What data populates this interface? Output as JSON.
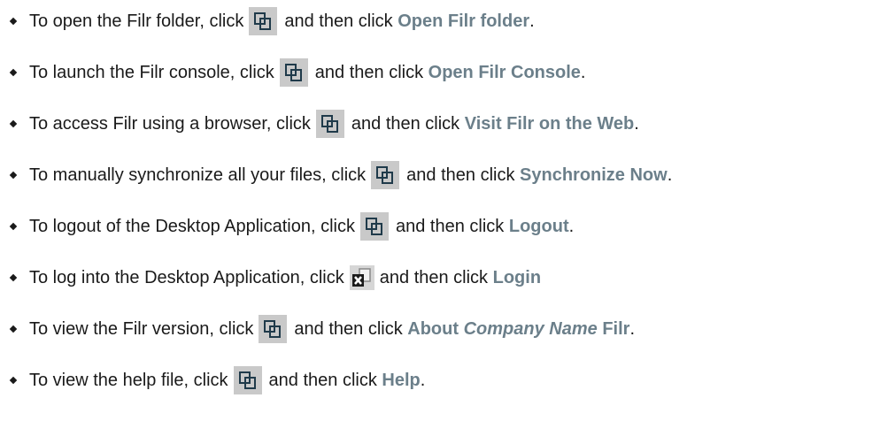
{
  "items": [
    {
      "prefix": "To open the Filr folder, click",
      "middle": "and then click",
      "command": "Open Filr folder",
      "end": ".",
      "icon": "filr-icon"
    },
    {
      "prefix": "To launch the Filr console, click",
      "middle": "and then click",
      "command": "Open Filr Console",
      "end": ".",
      "icon": "filr-icon"
    },
    {
      "prefix": "To access Filr using a browser, click",
      "middle": "and then click",
      "command": "Visit Filr on the Web",
      "end": ".",
      "icon": "filr-icon"
    },
    {
      "prefix": "To manually synchronize all your files, click",
      "middle": "and then click",
      "command": "Synchronize Now",
      "end": ".",
      "icon": "filr-icon"
    },
    {
      "prefix": "To logout of the Desktop Application, click",
      "middle": "and then click",
      "command": "Logout",
      "end": ".",
      "icon": "filr-icon"
    },
    {
      "prefix": "To log into the Desktop Application, click",
      "middle": "and then click",
      "command": "Login",
      "end": "",
      "icon": "filr-disconnected-icon"
    },
    {
      "prefix": "To view the Filr version, click",
      "middle": "and then click",
      "command_a": "About",
      "command_b": "Company Name",
      "command_c": "Filr",
      "end": ".",
      "icon": "filr-icon"
    },
    {
      "prefix": "To view the help file, click",
      "middle": "and then click",
      "command": "Help",
      "end": ".",
      "icon": "filr-icon"
    }
  ],
  "colors": {
    "command_text": "#6b7f8a",
    "icon_background": "#c9c9c9",
    "icon_stroke": "#1f3a4a"
  }
}
